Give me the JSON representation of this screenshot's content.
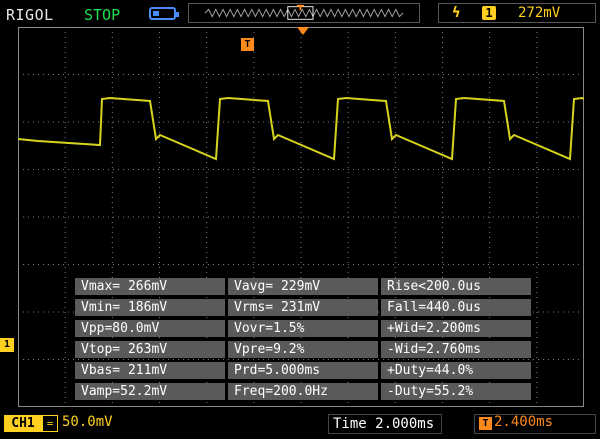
{
  "header": {
    "brand": "RIGOL",
    "run_status": "STOP",
    "trigger_source": "1",
    "trigger_level": "272mV",
    "battery_level_fraction": 0.3
  },
  "markers": {
    "trigger_position": "T",
    "ch1_ground": "1"
  },
  "measurements": [
    [
      "Vmax= 266mV",
      "Vavg= 229mV",
      "Rise<200.0us"
    ],
    [
      "Vmin= 186mV",
      "Vrms= 231mV",
      "Fall=440.0us"
    ],
    [
      "Vpp=80.0mV",
      "Vovr=1.5%",
      "+Wid=2.200ms"
    ],
    [
      "Vtop= 263mV",
      "Vpre=9.2%",
      "-Wid=2.760ms"
    ],
    [
      "Vbas= 211mV",
      "Prd=5.000ms",
      "+Duty=44.0%"
    ],
    [
      "Vamp=52.2mV",
      "Freq=200.0Hz",
      "-Duty=55.2%"
    ]
  ],
  "footer": {
    "channel_label": "CH1",
    "channel_coupling": "=",
    "channel_scale": "50.0mV",
    "timebase": "Time 2.000ms",
    "trigger_offset": "2.400ms",
    "trigger_offset_icon": "T"
  },
  "colors": {
    "channel1": "#d6d41e",
    "trigger": "#ff8a1c",
    "status_stop": "#20e050"
  },
  "icons": {
    "battery": "battery-icon",
    "trigger_edge": "falling-edge-icon",
    "memory_depth": "memory-waveform-icon"
  }
}
